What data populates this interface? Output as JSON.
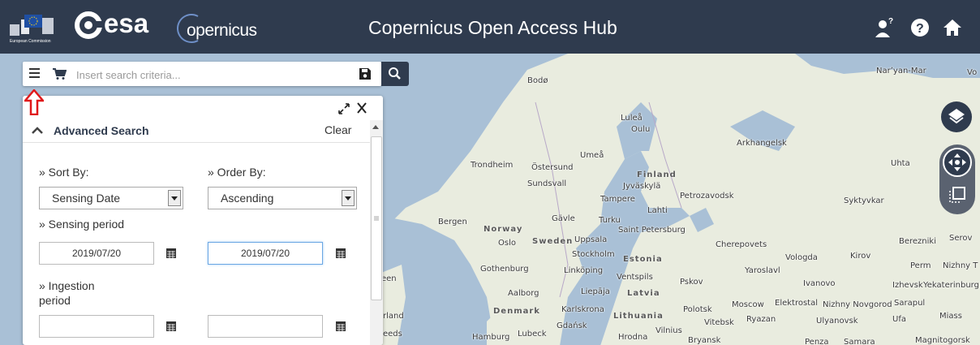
{
  "header": {
    "eu_logo_label": "European Commission",
    "esa_logo_text": "esa",
    "copernicus_logo_text": "opernicus",
    "title": "Copernicus Open Access Hub",
    "icons": [
      "user-help-icon",
      "help-icon",
      "home-icon"
    ]
  },
  "search": {
    "placeholder": "Insert search criteria..."
  },
  "panel": {
    "title": "Advanced Search",
    "clear_label": "Clear",
    "sort_by_label": "» Sort By:",
    "sort_by_value": "Sensing Date",
    "order_by_label": "» Order By:",
    "order_by_value": "Ascending",
    "sensing_period_label": "» Sensing period",
    "sensing_start": "2019/07/20",
    "sensing_end": "2019/07/20",
    "ingestion_period_label_1": "» Ingestion",
    "ingestion_period_label_2": "period",
    "ingestion_start": "",
    "ingestion_end": ""
  },
  "map": {
    "cities": [
      "Bodø",
      "Luleå",
      "Oulu",
      "Narʼyan-Mar",
      "Vo",
      "Arkhangelsk",
      "Umeå",
      "Trondheim",
      "Östersund",
      "Finland",
      "Uhta",
      "Sundsvall",
      "Jyväskylä",
      "Tampere",
      "Petrozavodsk",
      "Syktyvkar",
      "Lahti",
      "Gävle",
      "Turku",
      "Bergen",
      "Norway",
      "Saint Petersburg",
      "Oslo",
      "Sweden",
      "Uppsala",
      "Cherepovets",
      "Vologda",
      "Kirov",
      "Berezniki",
      "Serov",
      "Stockholm",
      "Estonia",
      "Perm",
      "Nizhny T",
      "Gothenburg",
      "Linköping",
      "Yaroslavl",
      "Ventspils",
      "Pskov",
      "Ivanovo",
      "Izhevsk",
      "Yekaterinburg",
      "Aalborg",
      "Liepāja",
      "Latvia",
      "Moscow",
      "Elektrostal",
      "Nizhny Novgorod",
      "Sarapul",
      "Denmark",
      "Karlskrona",
      "Lithuania",
      "Polotsk",
      "Vitebsk",
      "Ryazan",
      "Ulyanovsk",
      "Ufa",
      "Miass",
      "Gdańsk",
      "Vilnius",
      "Hamburg",
      "Lubeck",
      "Hrodna",
      "Bryansk",
      "Penza",
      "Samara",
      "Magnitogorsk",
      "een",
      "rland",
      "eeds"
    ]
  },
  "colors": {
    "header_bg": "#2f3b4e",
    "accent_arrow": "#e0191b",
    "water": "#a9c0d6",
    "land": "#e9ecdf"
  }
}
